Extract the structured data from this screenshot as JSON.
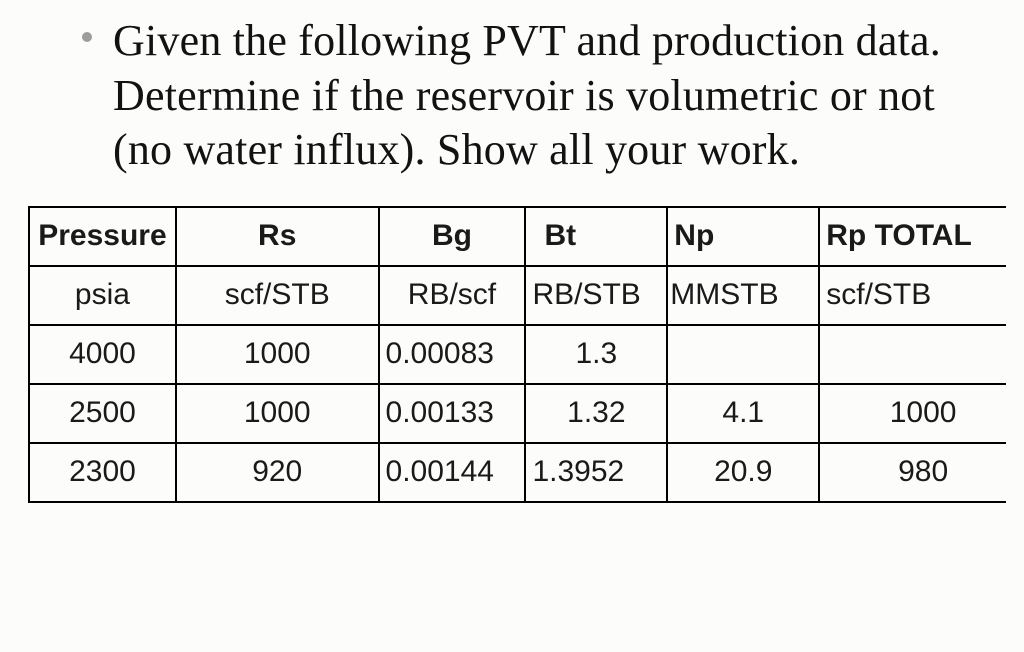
{
  "prompt": {
    "text": "Given the following PVT and production data. Determine if the reservoir is volumetric or not (no water influx). Show all your work."
  },
  "table": {
    "headers": {
      "pressure": "Pressure",
      "rs": "Rs",
      "bg": "Bg",
      "bt": "Bt",
      "np": "Np",
      "rp": "Rp TOTAL"
    },
    "units": {
      "pressure": "psia",
      "rs": "scf/STB",
      "bg": "RB/scf",
      "bt": "RB/STB",
      "np": "MMSTB",
      "rp": "scf/STB"
    },
    "rows": [
      {
        "pressure": "4000",
        "rs": "1000",
        "bg": "0.00083",
        "bt": "1.3",
        "np": "",
        "rp": ""
      },
      {
        "pressure": "2500",
        "rs": "1000",
        "bg": "0.00133",
        "bt": "1.32",
        "np": "4.1",
        "rp": "1000"
      },
      {
        "pressure": "2300",
        "rs": "920",
        "bg": "0.00144",
        "bt": "1.3952",
        "np": "20.9",
        "rp": "980"
      }
    ]
  },
  "chart_data": {
    "type": "table",
    "title": "PVT and production data",
    "columns": [
      "Pressure (psia)",
      "Rs (scf/STB)",
      "Bg (RB/scf)",
      "Bt (RB/STB)",
      "Np (MMSTB)",
      "Rp TOTAL (scf/STB)"
    ],
    "data": [
      [
        4000,
        1000,
        0.00083,
        1.3,
        null,
        null
      ],
      [
        2500,
        1000,
        0.00133,
        1.32,
        4.1,
        1000
      ],
      [
        2300,
        920,
        0.00144,
        1.3952,
        20.9,
        980
      ]
    ]
  }
}
